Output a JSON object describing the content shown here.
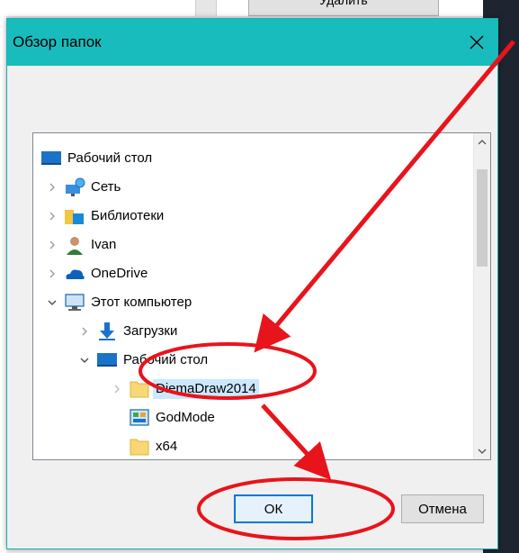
{
  "background": {
    "button_label": "Удалить"
  },
  "dialog": {
    "title": "Обзор папок",
    "ok_label": "ОК",
    "cancel_label": "Отмена"
  },
  "tree": {
    "items": [
      {
        "label": "Рабочий стол",
        "icon": "desktop-icon",
        "expander": "none"
      },
      {
        "label": "Сеть",
        "icon": "network-icon",
        "expander": "collapsed"
      },
      {
        "label": "Библиотеки",
        "icon": "libraries-icon",
        "expander": "collapsed"
      },
      {
        "label": "Ivan",
        "icon": "user-icon",
        "expander": "collapsed"
      },
      {
        "label": "OneDrive",
        "icon": "onedrive-icon",
        "expander": "collapsed"
      },
      {
        "label": "Этот компьютер",
        "icon": "computer-icon",
        "expander": "expanded"
      },
      {
        "label": "Загрузки",
        "icon": "downloads-icon",
        "expander": "collapsed"
      },
      {
        "label": "Рабочий стол",
        "icon": "desktop-icon",
        "expander": "expanded"
      },
      {
        "label": "DiemaDraw2014",
        "icon": "folder-icon",
        "expander": "collapsed",
        "selected": true
      },
      {
        "label": "GodMode",
        "icon": "control-panel-icon",
        "expander": "none"
      },
      {
        "label": "x64",
        "icon": "folder-icon",
        "expander": "none"
      }
    ]
  },
  "colors": {
    "titlebar": "#19bcbd",
    "annotation": "#e8141b",
    "selection": "#cce8ff",
    "ok_border": "#0078d7"
  }
}
